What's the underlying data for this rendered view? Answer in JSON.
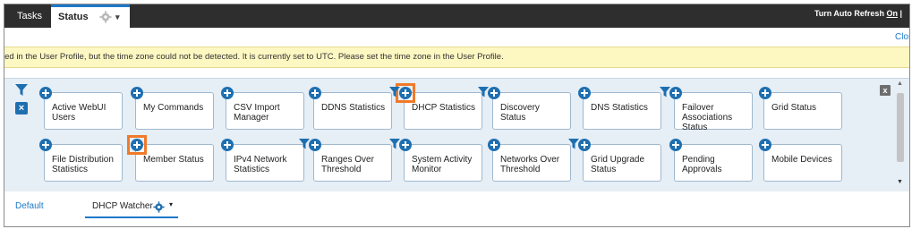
{
  "top_tabs": {
    "tasks": "Tasks",
    "status": "Status",
    "caret": "▾"
  },
  "refresh": {
    "label": "Turn Auto Refresh",
    "state": "On",
    "sep": "|"
  },
  "close_link": "Clos",
  "warning": "led in the User Profile, but the time zone could not be detected. It is currently set to UTC. Please set the time zone in the User Profile.",
  "dash_close": "x",
  "filter_clear": "×",
  "widgets_row1": [
    {
      "title": "Active WebUI Users",
      "filter": false,
      "highlight": false
    },
    {
      "title": "My Commands",
      "filter": false,
      "highlight": false
    },
    {
      "title": "CSV Import Manager",
      "filter": false,
      "highlight": false
    },
    {
      "title": "DDNS Statistics",
      "filter": false,
      "highlight": false
    },
    {
      "title": "DHCP Statistics",
      "filter": true,
      "highlight": true
    },
    {
      "title": "Discovery Status",
      "filter": true,
      "highlight": false
    },
    {
      "title": "DNS Statistics",
      "filter": false,
      "highlight": false
    },
    {
      "title": "Failover Associations Status",
      "filter": true,
      "highlight": false
    },
    {
      "title": "Grid Status",
      "filter": false,
      "highlight": false
    }
  ],
  "widgets_row2": [
    {
      "title": "File Distribution Statistics",
      "filter": false,
      "highlight": false
    },
    {
      "title": "Member Status",
      "filter": false,
      "highlight": true
    },
    {
      "title": "IPv4 Network Statistics",
      "filter": false,
      "highlight": false
    },
    {
      "title": "Ranges Over Threshold",
      "filter": true,
      "highlight": false
    },
    {
      "title": "System Activity Monitor",
      "filter": true,
      "highlight": false
    },
    {
      "title": "Networks Over Threshold",
      "filter": false,
      "highlight": false
    },
    {
      "title": "Grid Upgrade Status",
      "filter": true,
      "highlight": false
    },
    {
      "title": "Pending Approvals",
      "filter": false,
      "highlight": false
    },
    {
      "title": "Mobile Devices",
      "filter": false,
      "highlight": false
    }
  ],
  "bottom_tabs": {
    "default": "Default",
    "watcher": "DHCP Watcher",
    "caret": "▾"
  },
  "colors": {
    "accent": "#1e78c8",
    "highlight": "#f07a2a",
    "warning_bg": "#fdf7c2",
    "topbar": "#2e2e2e"
  }
}
